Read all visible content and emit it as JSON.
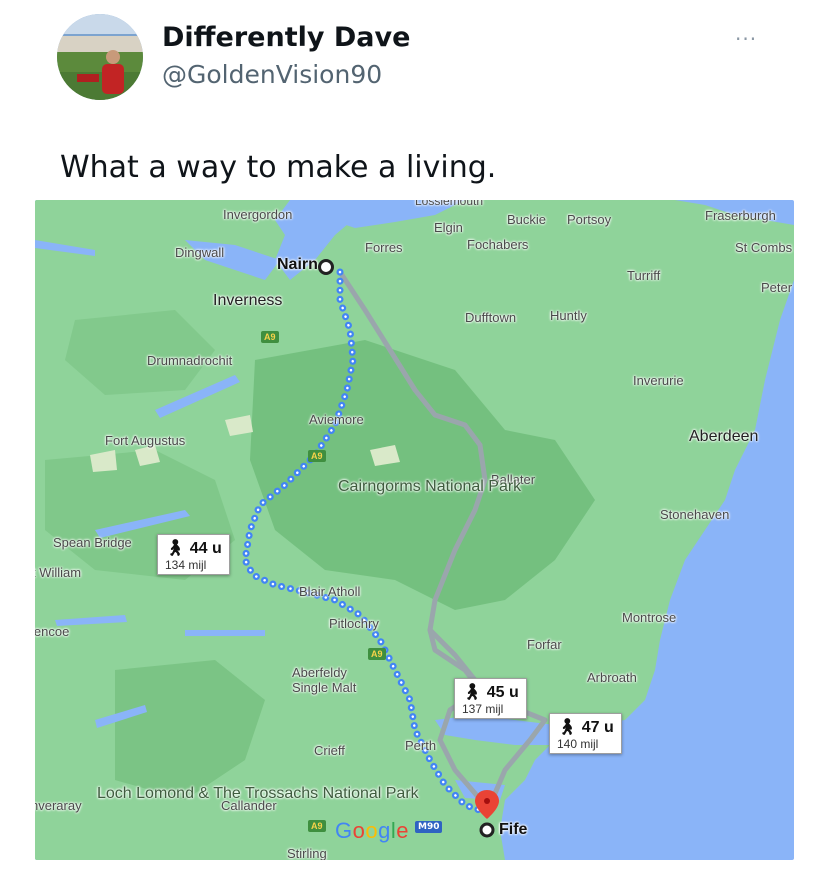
{
  "tweet": {
    "display_name": "Differently Dave",
    "handle": "@GoldenVision90",
    "more_glyph": "···",
    "text": "What a way to make a living."
  },
  "map": {
    "places": {
      "invergordon": "Invergordon",
      "lossiemouth": "Lossiemouth",
      "elgin": "Elgin",
      "buckie": "Buckie",
      "portsoy": "Portsoy",
      "fraserburgh": "Fraserburgh",
      "dingwall": "Dingwall",
      "forres": "Forres",
      "fochabers": "Fochabers",
      "st_combs": "St Combs",
      "nairn": "Nairn",
      "turriff": "Turriff",
      "peterhead": "Peter",
      "inverness": "Inverness",
      "dufftown": "Dufftown",
      "huntly": "Huntly",
      "drumnadrochit": "Drumnadrochit",
      "inverurie": "Inverurie",
      "aviemore": "Aviemore",
      "fort_augustus": "Fort Augustus",
      "aberdeen": "Aberdeen",
      "ballater": "Ballater",
      "cairngorms": "Cairngorms National Park",
      "stonehaven": "Stonehaven",
      "spean_bridge": "Spean Bridge",
      "fort_william": "t William",
      "blair_atholl": "Blair Atholl",
      "pitlochry": "Pitlochry",
      "montrose": "Montrose",
      "glencoe": "lencoe",
      "forfar": "Forfar",
      "aberfeldy": "Aberfeldy Single Malt",
      "arbroath": "Arbroath",
      "crieff": "Crieff",
      "perth": "Perth",
      "loch_lomond": "Loch Lomond & The Trossachs National Park",
      "inveraray": "nveraray",
      "callander": "Callander",
      "stirling": "Stirling",
      "fife": "Fife"
    },
    "roads": {
      "a9": "A9",
      "m90": "M90"
    },
    "routes": [
      {
        "time": "44 u",
        "distance": "134 mijl",
        "selected": true
      },
      {
        "time": "45 u",
        "distance": "137 mijl",
        "selected": false
      },
      {
        "time": "47 u",
        "distance": "140 mijl",
        "selected": false
      }
    ],
    "attribution": "Google",
    "walk_icon": "walking-person-icon",
    "colors": {
      "land": "#8fd39a",
      "water": "#8ab4f8",
      "route_selected": "#4285f4",
      "route_alt": "#9aa6ac",
      "destination_pin": "#ea4335"
    }
  }
}
